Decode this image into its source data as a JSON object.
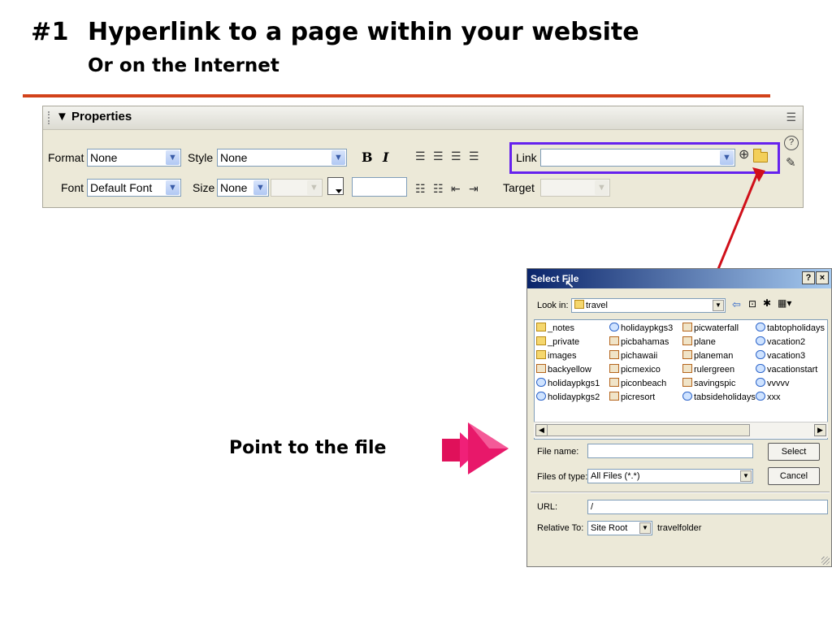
{
  "slide": {
    "number": "#1",
    "title": "Hyperlink to a page within your website",
    "subtitle": "Or on the Internet",
    "caption": "Point to the file"
  },
  "colors": {
    "rule": "#d2421a",
    "link_highlight": "#6622ee",
    "pointer_line": "#d0101a",
    "arrow": "#e0105a"
  },
  "properties": {
    "title": "Properties",
    "format_label": "Format",
    "format_value": "None",
    "style_label": "Style",
    "style_value": "None",
    "bold": "B",
    "italic": "I",
    "link_label": "Link",
    "link_value": "",
    "font_label": "Font",
    "font_value": "Default Font",
    "size_label": "Size",
    "size_value": "None",
    "target_label": "Target",
    "icons": [
      "align-left-icon",
      "align-center-icon",
      "align-right-icon",
      "justify-icon",
      "unordered-list-icon",
      "ordered-list-icon",
      "outdent-icon",
      "indent-icon",
      "point-to-file-icon",
      "browse-folder-icon",
      "help-icon",
      "edit-icon"
    ]
  },
  "dialog": {
    "title": "Select File",
    "help_btn": "?",
    "close_btn": "×",
    "look_in_label": "Look in:",
    "look_in_value": "travel",
    "files": [
      {
        "name": "_notes",
        "type": "folder"
      },
      {
        "name": "_private",
        "type": "folder"
      },
      {
        "name": "images",
        "type": "folder"
      },
      {
        "name": "backyellow",
        "type": "image"
      },
      {
        "name": "holidaypkgs1",
        "type": "html"
      },
      {
        "name": "holidaypkgs2",
        "type": "html"
      },
      {
        "name": "holidaypkgs3",
        "type": "html"
      },
      {
        "name": "picbahamas",
        "type": "image"
      },
      {
        "name": "pichawaii",
        "type": "image"
      },
      {
        "name": "picmexico",
        "type": "image"
      },
      {
        "name": "piconbeach",
        "type": "image"
      },
      {
        "name": "picresort",
        "type": "image"
      },
      {
        "name": "picwaterfall",
        "type": "image"
      },
      {
        "name": "plane",
        "type": "image"
      },
      {
        "name": "planeman",
        "type": "image"
      },
      {
        "name": "rulergreen",
        "type": "image"
      },
      {
        "name": "savingspic",
        "type": "image"
      },
      {
        "name": "tabsideholidays",
        "type": "html"
      },
      {
        "name": "tabtopholidays",
        "type": "html"
      },
      {
        "name": "vacation2",
        "type": "html"
      },
      {
        "name": "vacation3",
        "type": "html"
      },
      {
        "name": "vacationstart",
        "type": "html"
      },
      {
        "name": "vvvvv",
        "type": "html"
      },
      {
        "name": "xxx",
        "type": "html"
      }
    ],
    "file_name_label": "File name:",
    "file_name_value": "",
    "files_of_type_label": "Files of type:",
    "files_of_type_value": "All Files (*.*)",
    "select_btn": "Select",
    "cancel_btn": "Cancel",
    "url_label": "URL:",
    "url_value": "/",
    "relative_to_label": "Relative To:",
    "relative_to_value": "Site Root",
    "relative_folder": "travelfolder"
  }
}
